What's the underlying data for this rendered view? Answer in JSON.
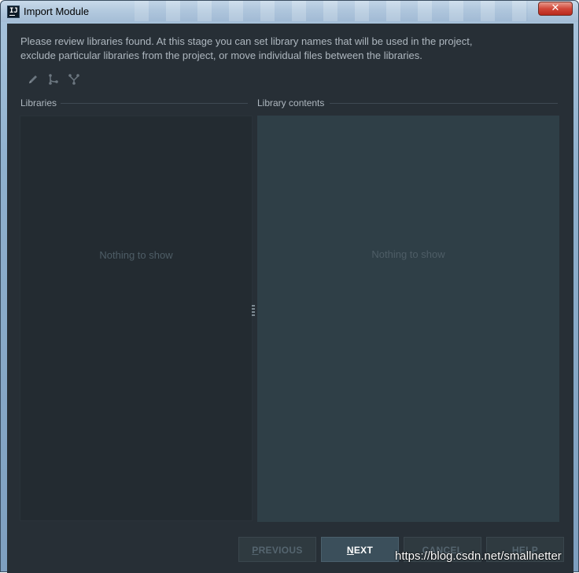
{
  "window": {
    "title": "Import Module",
    "close_glyph": "✕"
  },
  "description": {
    "line1": "Please review libraries found. At this stage you can set library names that will be used in the project,",
    "line2": "exclude particular libraries from the project, or move individual files between the libraries."
  },
  "toolbar": {
    "icons": [
      "edit-icon",
      "split-library-icon",
      "merge-libraries-icon"
    ]
  },
  "libraries_panel": {
    "label": "Libraries",
    "empty_text": "Nothing to show"
  },
  "contents_panel": {
    "label": "Library contents",
    "empty_text": "Nothing to show"
  },
  "buttons": {
    "previous": "PREVIOUS",
    "next": "NEXT",
    "cancel": "CANCEL",
    "help": "HELP"
  },
  "watermark": "https://blog.csdn.net/smallnetter",
  "colors": {
    "background": "#272f36",
    "right_panel": "#2f3f47",
    "text": "#aeb7bf",
    "muted_text": "#4e5d66",
    "next_button": "#3b4f5b"
  }
}
